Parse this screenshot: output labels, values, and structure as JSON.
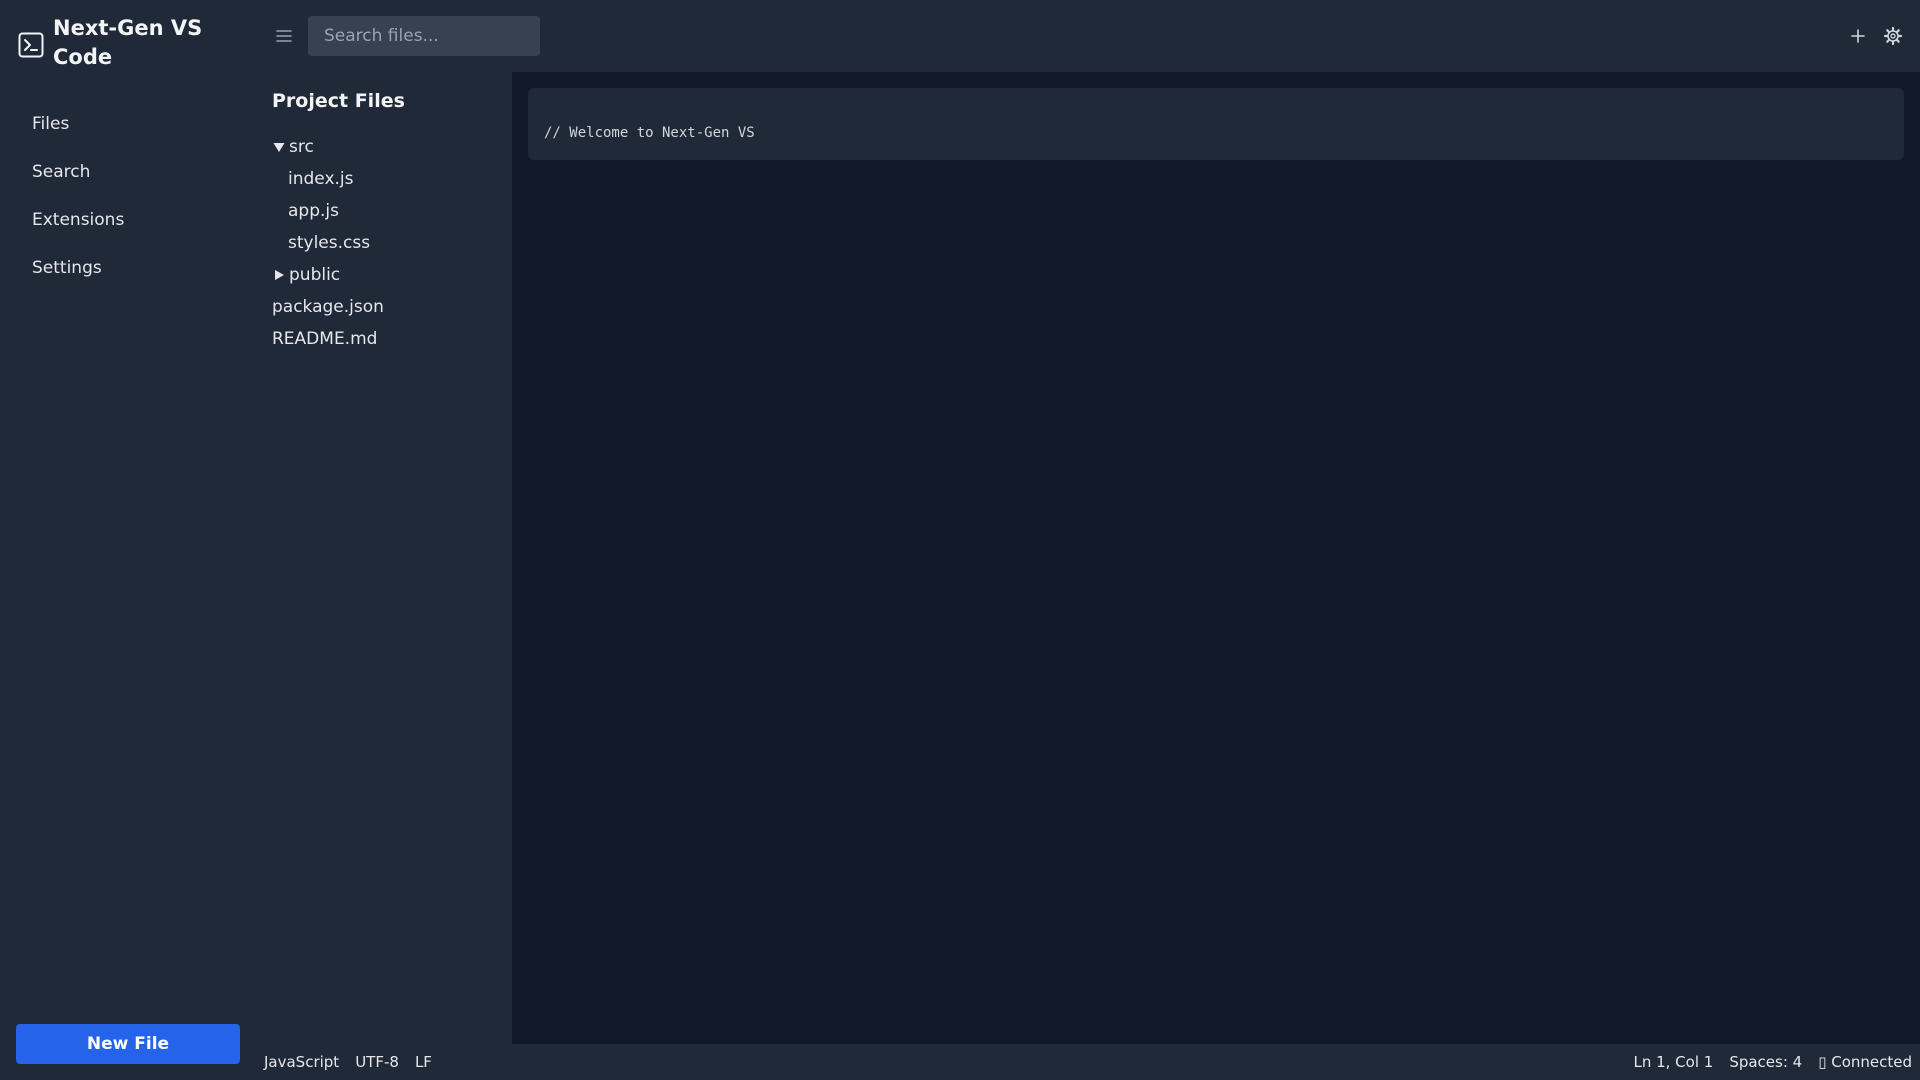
{
  "app": {
    "title": "Next-Gen VS Code"
  },
  "sidebar": {
    "items": [
      {
        "label": "Files"
      },
      {
        "label": "Search"
      },
      {
        "label": "Extensions"
      },
      {
        "label": "Settings"
      }
    ],
    "new_file_label": "New File"
  },
  "topbar": {
    "search_placeholder": "Search files..."
  },
  "filepanel": {
    "title": "Project Files",
    "tree": {
      "src": {
        "label": "src",
        "expanded": true,
        "children": [
          "index.js",
          "app.js",
          "styles.css"
        ]
      },
      "public": {
        "label": "public",
        "expanded": false
      },
      "files": [
        "package.json",
        "README.md"
      ]
    }
  },
  "editor": {
    "content": "// Welcome to Next-Gen VS"
  },
  "statusbar": {
    "language": "JavaScript",
    "encoding": "UTF-8",
    "line_ending": "LF",
    "cursor": "Ln 1, Col 1",
    "indent": "Spaces: 4",
    "connection": "▯ Connected"
  },
  "icons": {
    "brand": "terminal-icon",
    "menu": "menu-icon",
    "add": "plus-icon",
    "settings": "gear-icon"
  },
  "colors": {
    "accent": "#2563eb",
    "panel": "#1f2937",
    "editor_bg": "#111827"
  }
}
